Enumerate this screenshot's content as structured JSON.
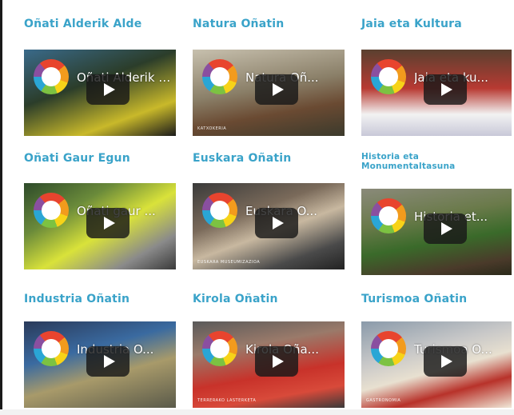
{
  "videos": [
    {
      "title": "Oñati Alderik Alde",
      "overlay": "Oñati Alderik Alde...",
      "caption": ""
    },
    {
      "title": "Natura Oñatin",
      "overlay": "Natura Oñ...",
      "caption": "KATXOKERIA"
    },
    {
      "title": "Jaia eta Kultura",
      "overlay": "Jaia eta ku...",
      "caption": ""
    },
    {
      "title": "Oñati Gaur Egun",
      "overlay": "Oñati gaur ...",
      "caption": ""
    },
    {
      "title": "Euskara Oñatin",
      "overlay": "Euskara O...",
      "caption": "EUSKARA MUSEUMIZAZIOA"
    },
    {
      "title": "Historia eta Monumentaltasuna",
      "overlay": "Historia et...",
      "caption": ""
    },
    {
      "title": "Industria Oñatin",
      "overlay": "Industria O...",
      "caption": ""
    },
    {
      "title": "Kirola Oñatin",
      "overlay": "Kirola Oña...",
      "caption": "TERRERAKO LASTERKETA"
    },
    {
      "title": "Turismoa Oñatin",
      "overlay": "Turismoa O...",
      "caption": "GASTRONOMIA"
    }
  ],
  "colors": {
    "title": "#3aa3c9",
    "play_bg": "#191919"
  }
}
